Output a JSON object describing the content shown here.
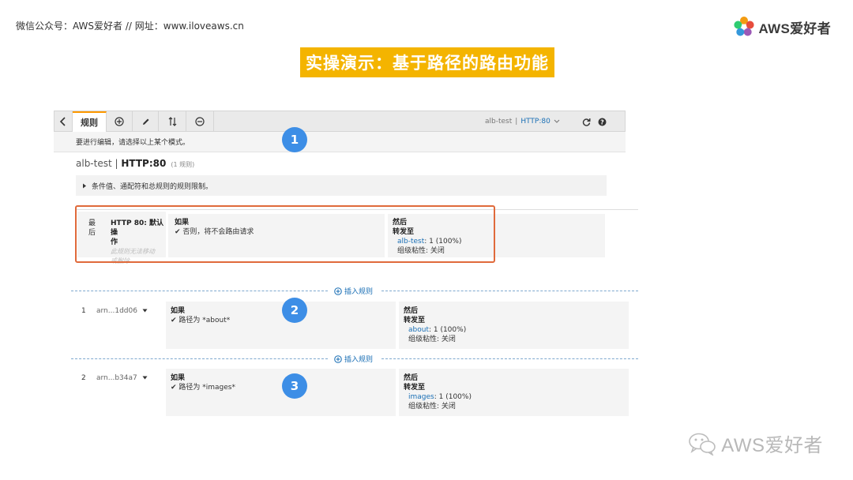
{
  "header": {
    "wechat_line": "微信公众号：AWS爱好者  //  网址：www.iloveaws.cn",
    "logo_text": "AWS爱好者"
  },
  "slide_title": "实操演示：基于路径的路由功能",
  "console": {
    "tab_label": "规则",
    "listener_selector": {
      "lb": "alb-test",
      "sep": "|",
      "listener": "HTTP:80"
    },
    "hint": "要进行编辑，请选择以上某个模式。",
    "lb_name": "alb-test",
    "lb_sep": " | ",
    "listener": "HTTP:80",
    "rule_count": "(1 规则)",
    "conditions_text": "条件值、通配符和总规则的规则限制。",
    "insert_rule": "插入规则",
    "rules": [
      {
        "num_line1": "最",
        "num_line2": "后",
        "name_line1": "HTTP 80: 默认操",
        "name_line2": "作",
        "note_line1": "此规则无法移动",
        "note_line2": "或删除",
        "if_label": "如果",
        "condition": "否则，将不会路由请求",
        "then_label": "然后",
        "action": "转发至",
        "target": "alb-test",
        "weight": ": 1 (100%)",
        "stickiness": "组级粘性: 关闭"
      },
      {
        "num": "1",
        "arn": "arn...1dd06",
        "if_label": "如果",
        "condition": "路径为 *about*",
        "then_label": "然后",
        "action": "转发至",
        "target": "about",
        "weight": ": 1 (100%)",
        "stickiness": "组级粘性: 关闭"
      },
      {
        "num": "2",
        "arn": "arn...b34a7",
        "if_label": "如果",
        "condition": "路径为 *images*",
        "then_label": "然后",
        "action": "转发至",
        "target": "images",
        "weight": ": 1 (100%)",
        "stickiness": "组级粘性: 关闭"
      }
    ]
  },
  "steps": [
    "1",
    "2",
    "3"
  ],
  "watermark": "AWS爱好者",
  "colors": {
    "title_bg": "#f4b400",
    "highlight_border": "#e06a3b",
    "step_circle": "#3d8ee6",
    "link": "#1a6fb5",
    "tab_accent": "#ff9900"
  }
}
